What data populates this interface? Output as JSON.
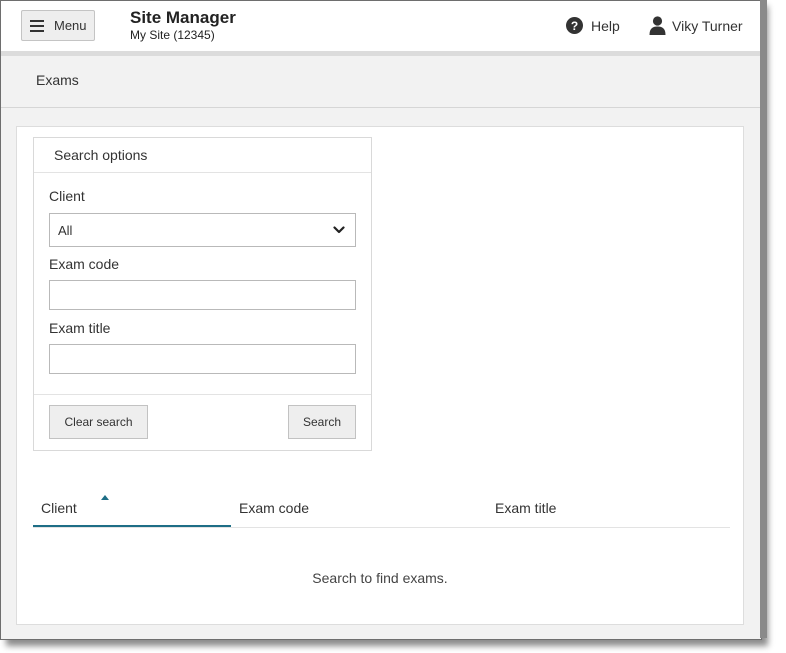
{
  "header": {
    "menu_label": "Menu",
    "site_title": "Site Manager",
    "site_subtitle": "My Site (12345)",
    "help_label": "Help",
    "user_name": "Viky Turner"
  },
  "breadcrumb": {
    "current": "Exams"
  },
  "search_panel": {
    "title": "Search options",
    "client_label": "Client",
    "client_selected": "All",
    "exam_code_label": "Exam code",
    "exam_code_value": "",
    "exam_title_label": "Exam title",
    "exam_title_value": "",
    "clear_button": "Clear search",
    "search_button": "Search"
  },
  "table": {
    "columns": [
      "Client",
      "Exam code",
      "Exam title"
    ],
    "sorted_column": "Client",
    "sort_direction": "ascending",
    "empty_message": "Search to find exams."
  },
  "colors": {
    "accent": "#1e6e86",
    "topbar_bg": "#ffffff",
    "page_bg": "#f2f2f2"
  },
  "icons": {
    "menu": "hamburger-icon",
    "help": "question-circle-icon",
    "user": "user-icon",
    "select": "chevron-down-icon",
    "sort": "sort-ascending-icon"
  }
}
